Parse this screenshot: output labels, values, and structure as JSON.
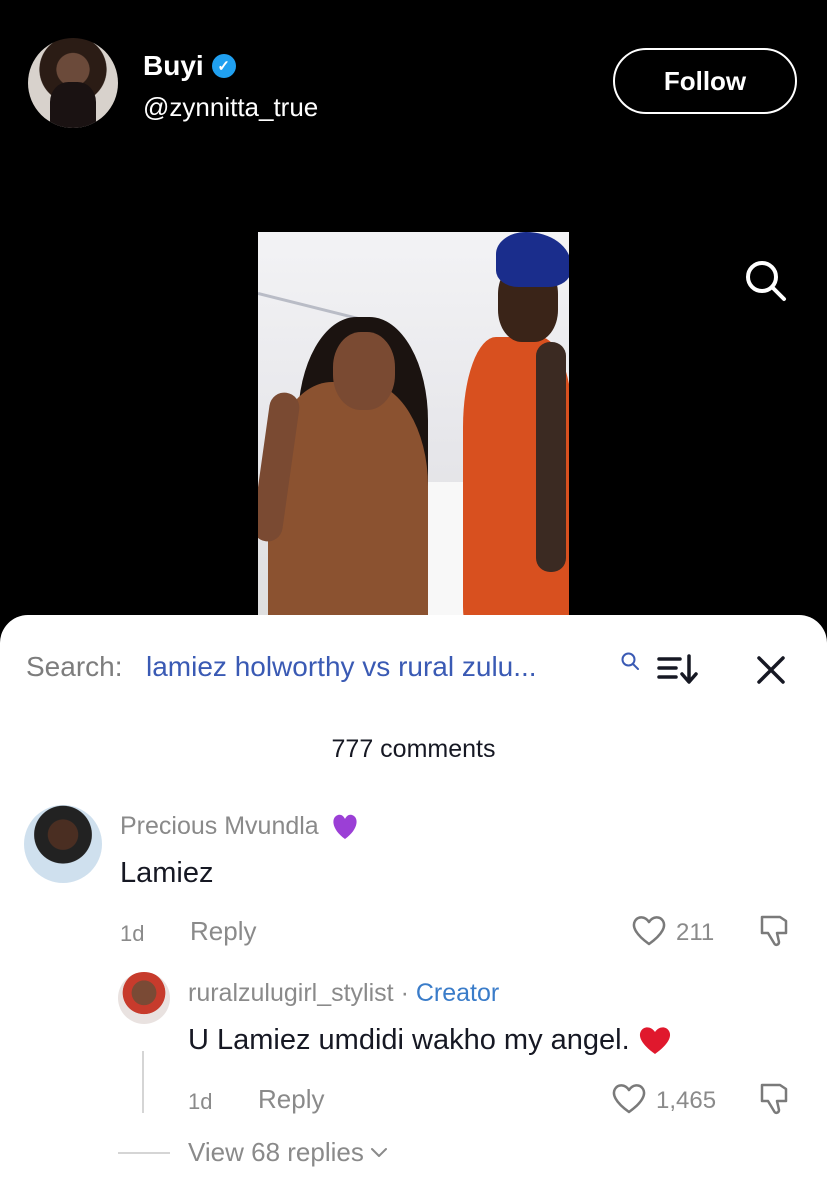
{
  "header": {
    "display_name": "Buyi",
    "verified_icon": "verified-check-icon",
    "handle": "@zynnitta_true",
    "follow_label": "Follow"
  },
  "comments_panel": {
    "search_label": "Search:",
    "search_query": "lamiez holworthy vs rural zulu...",
    "count_text": "777 comments",
    "comments": [
      {
        "author": "Precious Mvundla",
        "author_badge_icon": "purple-heart-icon",
        "text": "Lamiez",
        "time": "1d",
        "reply_label": "Reply",
        "likes": "211"
      }
    ],
    "reply": {
      "author": "ruralzulugirl_stylist",
      "separator": " · ",
      "badge": "Creator",
      "text": "U Lamiez umdidi wakho my angel.",
      "emoji_icon": "red-heart-icon",
      "time": "1d",
      "reply_label": "Reply",
      "likes": "1,465"
    },
    "view_replies": "View 68 replies"
  },
  "colors": {
    "background": "#000000",
    "panel": "#ffffff",
    "link_blue": "#3a5ab4",
    "creator_blue": "#3a7cc9",
    "muted": "#8a8a8a"
  }
}
